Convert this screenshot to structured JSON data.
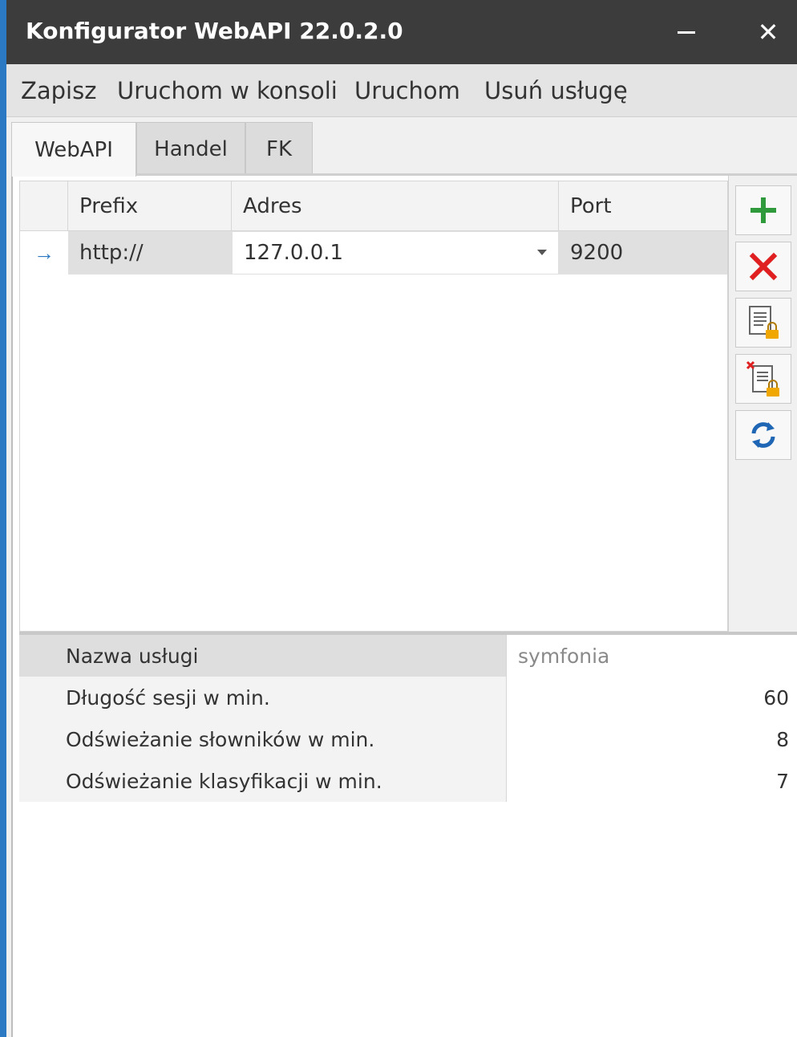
{
  "window": {
    "title": "Konfigurator WebAPI 22.0.2.0",
    "minimize_icon": "minimize-icon",
    "close_glyph": "✕"
  },
  "menu": [
    "Zapisz",
    "Uruchom w konsoli",
    "Uruchom",
    "Usuń usługę"
  ],
  "tabs": [
    {
      "label": "WebAPI",
      "active": true
    },
    {
      "label": "Handel",
      "active": false
    },
    {
      "label": "FK",
      "active": false
    }
  ],
  "grid": {
    "columns": [
      "Prefix",
      "Adres",
      "Port"
    ],
    "rows": [
      {
        "indicator": "→",
        "prefix": "http://",
        "address": "127.0.0.1",
        "port": "9200"
      }
    ]
  },
  "toolbar": [
    {
      "icon": "add-icon",
      "color": "#2e9a3c"
    },
    {
      "icon": "delete-icon",
      "color": "#e02020"
    },
    {
      "icon": "document-lock-icon",
      "color": "#f0a800"
    },
    {
      "icon": "document-delete-lock-icon",
      "color": "#f0a800"
    },
    {
      "icon": "refresh-icon",
      "color": "#1f66b5"
    }
  ],
  "properties": [
    {
      "label": "Nazwa usługi",
      "value": "symfonia"
    },
    {
      "label": "Długość sesji w min.",
      "value": "60"
    },
    {
      "label": "Odświeżanie słowników w min.",
      "value": "8"
    },
    {
      "label": "Odświeżanie klasyfikacji w min.",
      "value": "7"
    }
  ],
  "colors": {
    "titlebar": "#3c3c3c",
    "accent": "#2b79c2"
  }
}
